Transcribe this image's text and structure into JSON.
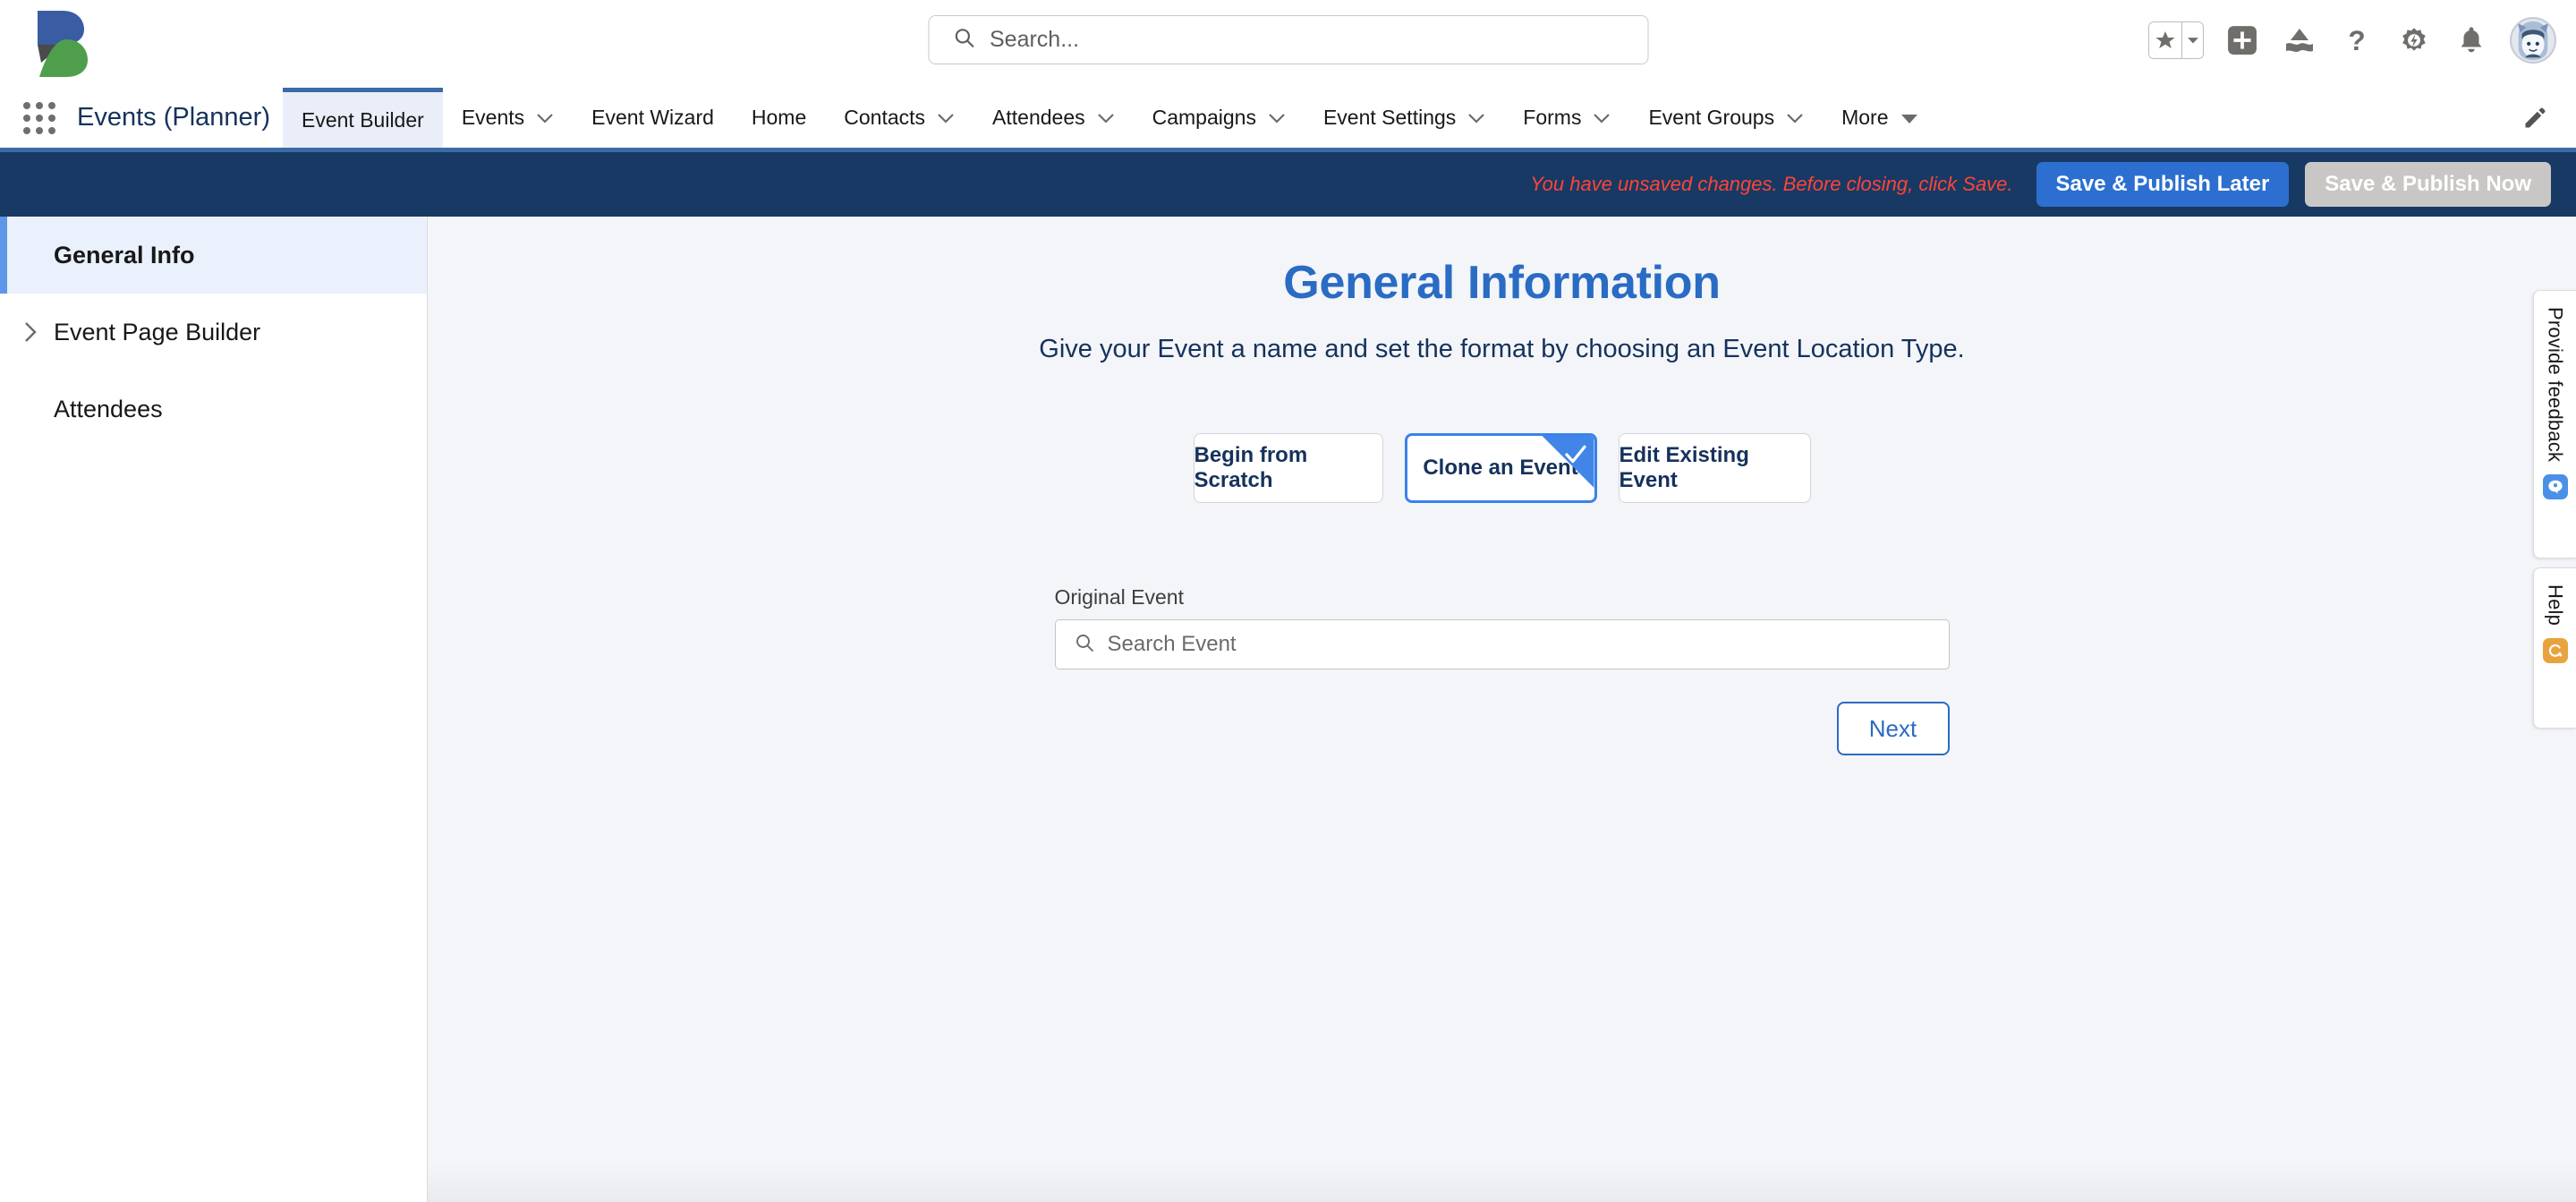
{
  "header": {
    "logo_name": "brand-logo-b",
    "search": {
      "placeholder": "Search...",
      "value": ""
    },
    "icons": [
      {
        "name": "favorites-star-icon",
        "label": "Favorites"
      },
      {
        "name": "favorites-dropdown-icon",
        "label": "Favorites list"
      },
      {
        "name": "global-actions-plus-icon",
        "label": "Global Actions"
      },
      {
        "name": "service-setup-icon",
        "label": "Service Setup"
      },
      {
        "name": "help-question-icon",
        "label": "Help"
      },
      {
        "name": "setup-gear-icon",
        "label": "Setup"
      },
      {
        "name": "notifications-bell-icon",
        "label": "Notifications"
      },
      {
        "name": "user-avatar",
        "label": "User Profile"
      }
    ]
  },
  "app_nav": {
    "waffle_label": "App Launcher",
    "app_name": "Events (Planner)",
    "tabs": [
      {
        "label": "Event Builder",
        "has_menu": false,
        "active": true
      },
      {
        "label": "Events",
        "has_menu": true,
        "active": false
      },
      {
        "label": "Event Wizard",
        "has_menu": false,
        "active": false
      },
      {
        "label": "Home",
        "has_menu": false,
        "active": false
      },
      {
        "label": "Contacts",
        "has_menu": true,
        "active": false
      },
      {
        "label": "Attendees",
        "has_menu": true,
        "active": false
      },
      {
        "label": "Campaigns",
        "has_menu": true,
        "active": false
      },
      {
        "label": "Event Settings",
        "has_menu": true,
        "active": false
      },
      {
        "label": "Forms",
        "has_menu": true,
        "active": false
      },
      {
        "label": "Event Groups",
        "has_menu": true,
        "active": false
      },
      {
        "label": "More",
        "has_menu": true,
        "active": false
      }
    ],
    "edit_label": "Edit Navigation"
  },
  "action_bar": {
    "unsaved_message": "You have unsaved changes. Before closing, click Save.",
    "save_later_label": "Save & Publish Later",
    "save_now_label": "Save & Publish Now"
  },
  "sidebar": {
    "items": [
      {
        "label": "General Info",
        "active": true,
        "expandable": false
      },
      {
        "label": "Event Page Builder",
        "active": false,
        "expandable": true
      },
      {
        "label": "Attendees",
        "active": false,
        "expandable": false
      }
    ]
  },
  "main": {
    "title": "General Information",
    "subtitle": "Give your Event a name and set the format by choosing an Event Location Type.",
    "choices": [
      {
        "label": "Begin from Scratch",
        "selected": false
      },
      {
        "label": "Clone an Event",
        "selected": true
      },
      {
        "label": "Edit Existing Event",
        "selected": false
      }
    ],
    "original_event": {
      "label": "Original Event",
      "placeholder": "Search Event",
      "value": ""
    },
    "next_label": "Next"
  },
  "util_rail": {
    "tabs": [
      {
        "label": "Provide feedback",
        "badge_color": "#4a90e8",
        "badge_icon": "feedback-icon"
      },
      {
        "label": "Help",
        "badge_color": "#e8a33d",
        "badge_icon": "help-lifering-icon"
      }
    ]
  },
  "colors": {
    "navy_bar": "#183963",
    "nav_underline": "#3B6BA5",
    "primary_blue": "#2d6fd0",
    "title_blue": "#2a6bc4",
    "selected_blue": "#4285e8",
    "warning_red": "#ff4438",
    "main_bg": "#F3F5F9",
    "active_tab_bg": "#E9EEF8",
    "sidebar_active_bg": "#EAF1FC"
  }
}
